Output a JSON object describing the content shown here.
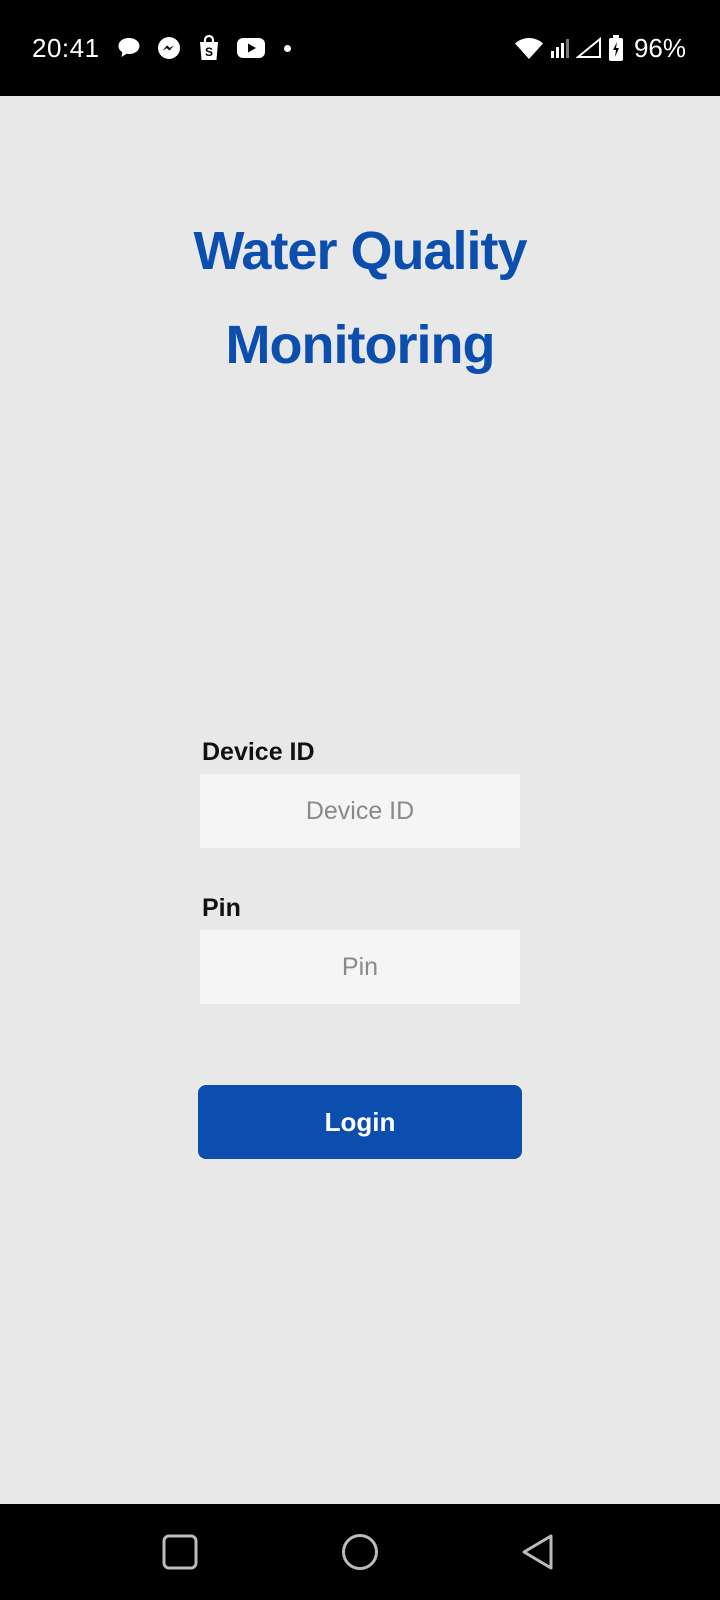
{
  "status_bar": {
    "time": "20:41",
    "notification_icons": [
      "chat-bubble-icon",
      "messenger-icon",
      "shopping-bag-icon",
      "youtube-icon",
      "more-dot-icon"
    ],
    "system_icons": [
      "wifi-icon",
      "signal-icon",
      "signal-empty-icon",
      "battery-charging-icon"
    ],
    "battery_percent": "96%"
  },
  "app": {
    "title_line1": "Water Quality",
    "title_line2": "Monitoring",
    "device_id": {
      "label": "Device ID",
      "placeholder": "Device ID",
      "value": ""
    },
    "pin": {
      "label": "Pin",
      "placeholder": "Pin",
      "value": ""
    },
    "login_label": "Login"
  },
  "colors": {
    "accent": "#0b4eae",
    "background": "#e8e8e8",
    "input_background": "#f5f5f5"
  },
  "nav_bar": {
    "buttons": [
      "recents-icon",
      "home-icon",
      "back-icon"
    ]
  }
}
